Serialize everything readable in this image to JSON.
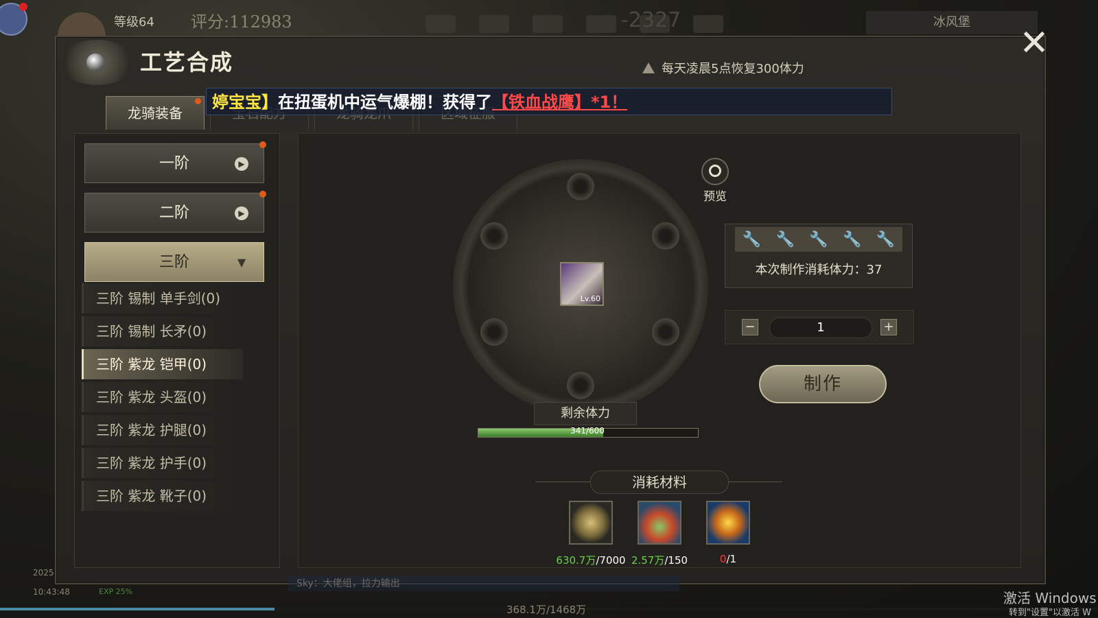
{
  "hud": {
    "level": "等级64",
    "score": "评分:112983",
    "hud_number": "-2327",
    "location": "冰风堡",
    "time": "10:43:48",
    "date": "2025",
    "exp_percent_text": "EXP 25%",
    "exp_text": "368.1万/1468万",
    "exp_fraction": 0.25,
    "chat_text": "Sky：大佬组，拉力输出"
  },
  "panel": {
    "title": "工艺合成",
    "notice": "每天凌晨5点恢复300体力",
    "close": "✕"
  },
  "tabs": [
    {
      "label": "龙骑装备",
      "active": true
    },
    {
      "label": "宝石配方",
      "active": false
    },
    {
      "label": "龙骑龙爪",
      "active": false
    },
    {
      "label": "区域征服",
      "active": false
    }
  ],
  "broadcast": {
    "name": "婷宝宝】",
    "text": "在扭蛋机中运气爆棚！获得了",
    "item": "【铁血战鹰】*1！"
  },
  "tiers": [
    {
      "label": "一阶"
    },
    {
      "label": "二阶"
    },
    {
      "label": "三阶"
    }
  ],
  "sub_items": [
    "三阶 锡制 单手剑(0)",
    "三阶 锡制 长矛(0)",
    "三阶 紫龙 铠甲(0)",
    "三阶 紫龙 头盔(0)",
    "三阶 紫龙 护腿(0)",
    "三阶 紫龙 护手(0)",
    "三阶 紫龙 靴子(0)"
  ],
  "craft": {
    "item_level": "Lv.60",
    "preview_label": "预览",
    "stamina_label": "剩余体力",
    "stamina_text": "341/600",
    "stamina_fraction": 0.568,
    "cost_text": "本次制作消耗体力：37",
    "quantity": "1",
    "make_label": "制作",
    "minus": "−",
    "plus": "+"
  },
  "materials": {
    "title": "消耗材料",
    "items": [
      {
        "have": "630.7万",
        "need": "/7000",
        "enough": true
      },
      {
        "have": "2.57万",
        "need": "/150",
        "enough": true
      },
      {
        "have": "0",
        "need": "/1",
        "enough": false
      }
    ]
  },
  "os": {
    "activate_title": "激活 Windows",
    "activate_hint": "转到\"设置\"以激活 W"
  }
}
